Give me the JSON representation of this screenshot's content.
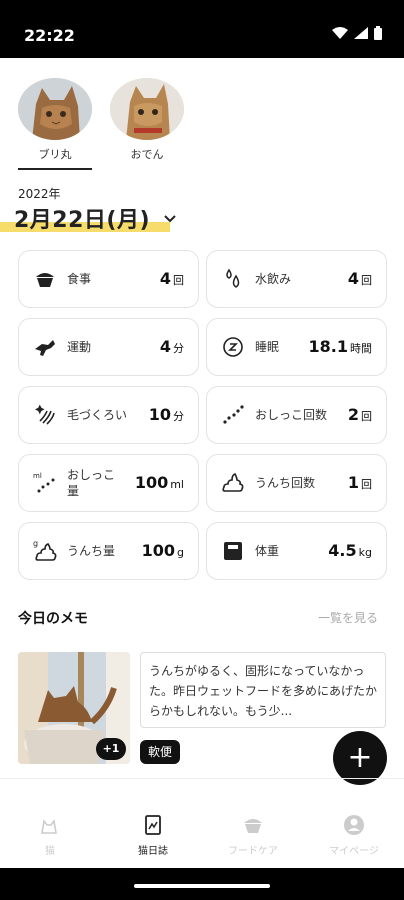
{
  "status": {
    "time": "22:22"
  },
  "pets": [
    {
      "name": "ブリ丸",
      "active": true
    },
    {
      "name": "おでん",
      "active": false
    }
  ],
  "date": {
    "year": "2022年",
    "day": "2月22日(月)"
  },
  "cards": [
    {
      "label": "食事",
      "value": "4",
      "unit": "回",
      "icon": "bowl-icon"
    },
    {
      "label": "水飲み",
      "value": "4",
      "unit": "回",
      "icon": "water-drops-icon"
    },
    {
      "label": "運動",
      "value": "4",
      "unit": "分",
      "icon": "running-cat-icon"
    },
    {
      "label": "睡眠",
      "value": "18.1",
      "unit": "時間",
      "icon": "sleep-icon"
    },
    {
      "label": "毛づくろい",
      "value": "10",
      "unit": "分",
      "icon": "grooming-icon"
    },
    {
      "label": "おしっこ回数",
      "value": "2",
      "unit": "回",
      "icon": "pee-count-icon"
    },
    {
      "label": "おしっこ\n量",
      "value": "100",
      "unit": "ml",
      "icon": "pee-amount-icon"
    },
    {
      "label": "うんち回数",
      "value": "1",
      "unit": "回",
      "icon": "poop-count-icon"
    },
    {
      "label": "うんち量",
      "value": "100",
      "unit": "g",
      "icon": "poop-amount-icon"
    },
    {
      "label": "体重",
      "value": "4.5",
      "unit": "kg",
      "icon": "scale-icon"
    }
  ],
  "memo": {
    "title": "今日のメモ",
    "link": "一覧を見る",
    "photo_count": "+1",
    "text": "うんちがゆるく、固形になっていなかった。昨日ウェットフードを多めにあげたからかもしれない。もう少...",
    "tag": "軟便"
  },
  "fab": {
    "symbol": "+"
  },
  "nav": [
    {
      "label": "猫",
      "icon": "cat-icon",
      "active": false
    },
    {
      "label": "猫日誌",
      "icon": "diary-icon",
      "active": true
    },
    {
      "label": "フードケア",
      "icon": "food-care-icon",
      "active": false
    },
    {
      "label": "マイページ",
      "icon": "profile-icon",
      "active": false
    }
  ]
}
